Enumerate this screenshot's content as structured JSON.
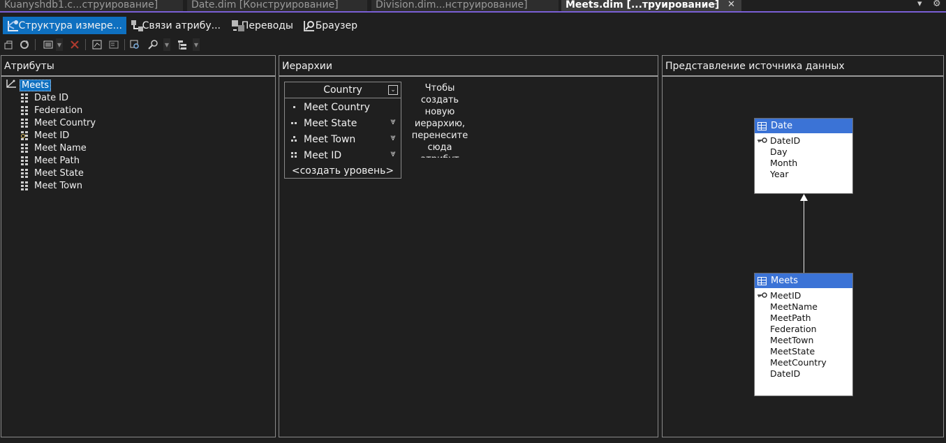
{
  "doc_tabs": [
    {
      "label": "Kuanyshdb1.c...струирование]"
    },
    {
      "label": "Date.dim [Конструирование]"
    },
    {
      "label": "Division.dim...нструирование]"
    },
    {
      "label": "Meets.dim [...труирование]"
    }
  ],
  "designer_tabs": [
    {
      "label": "Структура измере...",
      "icon": "dimension-structure-icon"
    },
    {
      "label": "Связи атрибу...",
      "icon": "attribute-relationships-icon"
    },
    {
      "label": "Переводы",
      "icon": "translations-icon"
    },
    {
      "label": "Браузер",
      "icon": "browser-icon"
    }
  ],
  "attributes_panel": {
    "title": "Атрибуты",
    "root": "Meets",
    "items": [
      {
        "label": "Date ID",
        "icon": "attribute-icon"
      },
      {
        "label": "Federation",
        "icon": "attribute-icon"
      },
      {
        "label": "Meet Country",
        "icon": "attribute-icon"
      },
      {
        "label": "Meet ID",
        "icon": "key-attribute-icon"
      },
      {
        "label": "Meet Name",
        "icon": "attribute-icon"
      },
      {
        "label": "Meet Path",
        "icon": "attribute-icon"
      },
      {
        "label": "Meet State",
        "icon": "attribute-icon"
      },
      {
        "label": "Meet Town",
        "icon": "attribute-icon"
      }
    ]
  },
  "hierarchies_panel": {
    "title": "Иерархии",
    "hierarchy": {
      "name": "Country",
      "levels": [
        {
          "label": "Meet Country"
        },
        {
          "label": "Meet State"
        },
        {
          "label": "Meet Town"
        },
        {
          "label": "Meet ID"
        }
      ],
      "new_level": "<создать уровень>"
    },
    "hint": "Чтобы создать новую иерархию, перенесите сюда атрибут"
  },
  "dsv_panel": {
    "title": "Представление источника данных",
    "tables": [
      {
        "name": "Date",
        "columns": [
          "DateID",
          "Day",
          "Month",
          "Year"
        ],
        "key": "DateID"
      },
      {
        "name": "Meets",
        "columns": [
          "MeetID",
          "MeetName",
          "MeetPath",
          "Federation",
          "MeetTown",
          "MeetState",
          "MeetCountry",
          "DateID"
        ],
        "key": "MeetID"
      }
    ]
  },
  "colors": {
    "background": "#1f1f1f",
    "accent": "#0e70c0",
    "tab_underline": "#7a5fd6",
    "table_header": "#3b73d6"
  }
}
